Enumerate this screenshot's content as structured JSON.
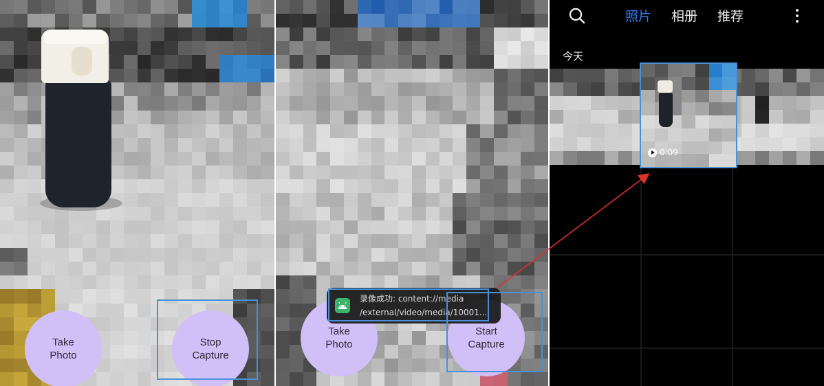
{
  "panel1": {
    "take_photo_button": "Take\nPhoto",
    "capture_button": "Stop\nCapture"
  },
  "panel2": {
    "take_photo_button": "Take\nPhoto",
    "capture_button": "Start\nCapture",
    "toast": {
      "icon": "android-icon",
      "line1": "录像成功: content://media",
      "line2": "/external/video/media/10001..."
    }
  },
  "gallery": {
    "search_icon": "search-icon",
    "tabs": [
      "照片",
      "相册",
      "推荐"
    ],
    "active_tab": "照片",
    "more_icon": "more-vertical-icon",
    "date_header": "今天",
    "video_duration": "0:09"
  },
  "colors": {
    "button_fill": "#d1bff7",
    "highlight": "#4a90d9",
    "active_tab": "#2e7cf6",
    "annotation_arrow": "#e0312b"
  }
}
